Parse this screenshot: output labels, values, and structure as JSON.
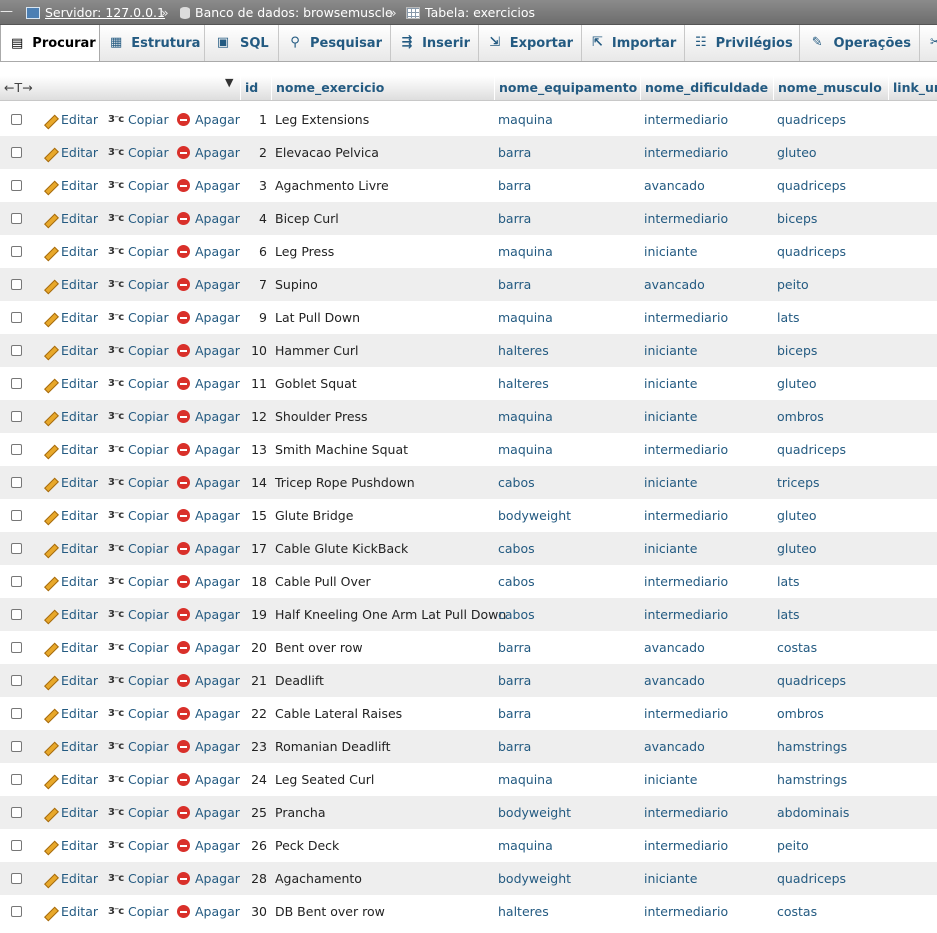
{
  "breadcrumb": {
    "server": "Servidor: 127.0.0.1",
    "database": "Banco de dados: browsemuscle",
    "table": "Tabela: exercicios",
    "separator": "»"
  },
  "tabs": [
    {
      "label": "Procurar",
      "icon": "browse-icon",
      "active": true
    },
    {
      "label": "Estrutura",
      "icon": "structure-icon"
    },
    {
      "label": "SQL",
      "icon": "sql-icon"
    },
    {
      "label": "Pesquisar",
      "icon": "search-icon"
    },
    {
      "label": "Inserir",
      "icon": "insert-icon"
    },
    {
      "label": "Exportar",
      "icon": "export-icon"
    },
    {
      "label": "Importar",
      "icon": "import-icon"
    },
    {
      "label": "Privilégios",
      "icon": "privileges-icon"
    },
    {
      "label": "Operações",
      "icon": "operations-icon"
    }
  ],
  "table": {
    "column_resize_glyph": "←T→",
    "columns": [
      "id",
      "nome_exercicio",
      "nome_equipamento",
      "nome_dificuldade",
      "nome_musculo",
      "link_ur"
    ],
    "actions": {
      "edit": "Editar",
      "copy": "Copiar",
      "delete": "Apagar"
    },
    "rows": [
      [
        "1",
        "Leg Extensions",
        "maquina",
        "intermediario",
        "quadriceps"
      ],
      [
        "2",
        "Elevacao Pelvica",
        "barra",
        "intermediario",
        "gluteo"
      ],
      [
        "3",
        "Agachmento Livre",
        "barra",
        "avancado",
        "quadriceps"
      ],
      [
        "4",
        "Bicep Curl",
        "barra",
        "intermediario",
        "biceps"
      ],
      [
        "6",
        "Leg Press",
        "maquina",
        "iniciante",
        "quadriceps"
      ],
      [
        "7",
        "Supino",
        "barra",
        "avancado",
        "peito"
      ],
      [
        "9",
        "Lat Pull Down",
        "maquina",
        "intermediario",
        "lats"
      ],
      [
        "10",
        "Hammer Curl",
        "halteres",
        "iniciante",
        "biceps"
      ],
      [
        "11",
        "Goblet Squat",
        "halteres",
        "iniciante",
        "gluteo"
      ],
      [
        "12",
        "Shoulder Press",
        "maquina",
        "iniciante",
        "ombros"
      ],
      [
        "13",
        "Smith Machine Squat",
        "maquina",
        "intermediario",
        "quadriceps"
      ],
      [
        "14",
        "Tricep Rope Pushdown",
        "cabos",
        "iniciante",
        "triceps"
      ],
      [
        "15",
        "Glute Bridge",
        "bodyweight",
        "intermediario",
        "gluteo"
      ],
      [
        "17",
        "Cable Glute KickBack",
        "cabos",
        "iniciante",
        "gluteo"
      ],
      [
        "18",
        "Cable Pull Over",
        "cabos",
        "intermediario",
        "lats"
      ],
      [
        "19",
        "Half Kneeling One Arm Lat Pull Down",
        "cabos",
        "intermediario",
        "lats"
      ],
      [
        "20",
        "Bent over row",
        "barra",
        "avancado",
        "costas"
      ],
      [
        "21",
        "Deadlift",
        "barra",
        "avancado",
        "quadriceps"
      ],
      [
        "22",
        "Cable Lateral Raises",
        "barra",
        "intermediario",
        "ombros"
      ],
      [
        "23",
        "Romanian Deadlift",
        "barra",
        "avancado",
        "hamstrings"
      ],
      [
        "24",
        "Leg Seated Curl",
        "maquina",
        "iniciante",
        "hamstrings"
      ],
      [
        "25",
        "Prancha",
        "bodyweight",
        "intermediario",
        "abdominais"
      ],
      [
        "26",
        "Peck Deck",
        "maquina",
        "intermediario",
        "peito"
      ],
      [
        "28",
        "Agachamento",
        "bodyweight",
        "iniciante",
        "quadriceps"
      ],
      [
        "30",
        "DB Bent over row",
        "halteres",
        "intermediario",
        "costas"
      ]
    ]
  }
}
